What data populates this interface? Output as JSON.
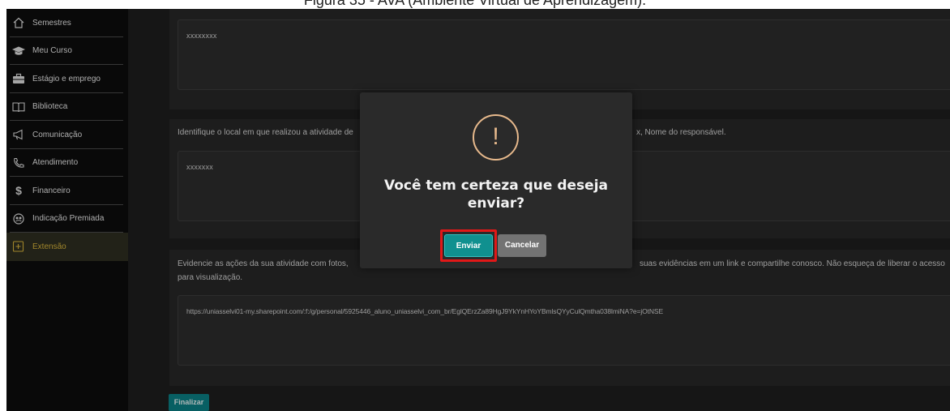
{
  "caption": "Figura 35 - AVA (Ambiente Virtual de Aprendizagem).",
  "sidebar": {
    "items": [
      {
        "label": "Semestres",
        "icon": "home-icon"
      },
      {
        "label": "Meu Curso",
        "icon": "graduation-cap-icon"
      },
      {
        "label": "Estágio e emprego",
        "icon": "briefcase-icon"
      },
      {
        "label": "Biblioteca",
        "icon": "book-icon"
      },
      {
        "label": "Comunicação",
        "icon": "megaphone-icon"
      },
      {
        "label": "Atendimento",
        "icon": "phone-icon"
      },
      {
        "label": "Financeiro",
        "icon": "dollar-icon"
      },
      {
        "label": "Indicação Premiada",
        "icon": "referral-icon"
      },
      {
        "label": "Extensão",
        "icon": "plus-square-icon",
        "active": true
      }
    ]
  },
  "form": {
    "field1_value": "xxxxxxxx",
    "field2_label": "Identifique o local em que realizou a atividade de",
    "field2_label_tail": "x, Nome do responsável.",
    "field2_value": "xxxxxxx",
    "field3_label_start": "Evidencie as ações da sua atividade com fotos,",
    "field3_label_end": "suas evidências em um link e compartilhe conosco. Não esqueça de liberar o acesso",
    "field3_label_line2": "para visualização.",
    "field3_value": "https://uniasselvi01-my.sharepoint.com/:f:/g/personal/5925446_aluno_uniasselvi_com_br/EglQErzZa89HgJ9YkYnHYoYBmlsQYyCulQmtha038lmiNA?e=jOtNSE",
    "submit_label": "Finalizar"
  },
  "modal": {
    "icon": "exclamation-icon",
    "title": "Você tem certeza que deseja enviar?",
    "confirm_label": "Enviar",
    "cancel_label": "Cancelar"
  },
  "colors": {
    "accent": "#10908f",
    "active_nav": "#d6b23a",
    "warning": "#e7b98c",
    "highlight": "#e11818"
  }
}
